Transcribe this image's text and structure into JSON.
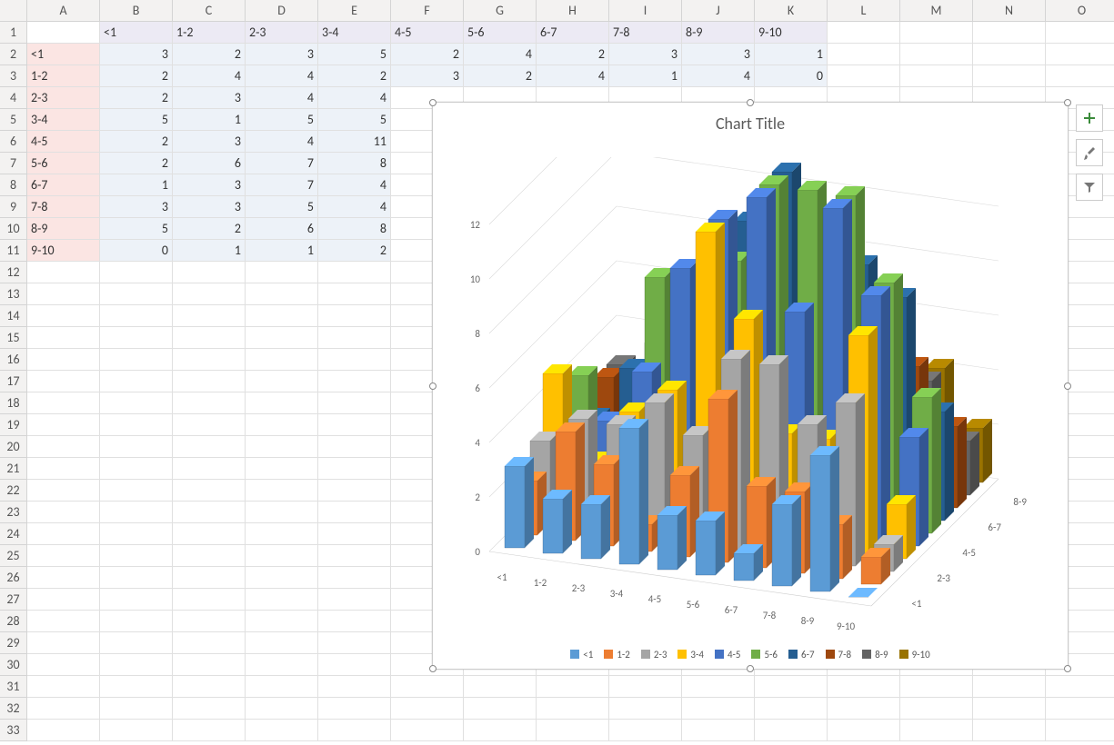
{
  "columns": [
    "A",
    "B",
    "C",
    "D",
    "E",
    "F",
    "G",
    "H",
    "I",
    "J",
    "K",
    "L",
    "M",
    "N",
    "O"
  ],
  "rowCount": 33,
  "colHeaders": [
    "<1",
    "1-2",
    "2-3",
    "3-4",
    "4-5",
    "5-6",
    "6-7",
    "7-8",
    "8-9",
    "9-10"
  ],
  "rowCats": [
    "<1",
    "1-2",
    "2-3",
    "3-4",
    "4-5",
    "5-6",
    "6-7",
    "7-8",
    "8-9",
    "9-10"
  ],
  "table": [
    [
      3,
      2,
      3,
      5,
      2,
      4,
      2,
      3,
      3,
      1
    ],
    [
      2,
      4,
      4,
      2,
      3,
      2,
      4,
      1,
      4,
      0
    ],
    [
      2,
      3,
      4,
      4,
      null,
      null,
      null,
      null,
      null,
      null
    ],
    [
      5,
      1,
      5,
      5,
      null,
      null,
      null,
      null,
      null,
      null
    ],
    [
      2,
      3,
      4,
      11,
      null,
      null,
      null,
      null,
      null,
      null
    ],
    [
      2,
      6,
      7,
      8,
      null,
      null,
      null,
      null,
      null,
      null
    ],
    [
      1,
      3,
      7,
      4,
      null,
      null,
      null,
      null,
      null,
      null
    ],
    [
      3,
      3,
      5,
      4,
      null,
      null,
      null,
      null,
      null,
      null
    ],
    [
      5,
      2,
      6,
      8,
      null,
      null,
      null,
      null,
      null,
      null
    ],
    [
      0,
      1,
      1,
      2,
      null,
      null,
      null,
      null,
      null,
      null
    ]
  ],
  "chart_data": {
    "type": "bar",
    "title": "Chart Title",
    "categories": [
      "<1",
      "1-2",
      "2-3",
      "3-4",
      "4-5",
      "5-6",
      "6-7",
      "7-8",
      "8-9",
      "9-10"
    ],
    "depth_categories": [
      "<1",
      "1-2",
      "2-3",
      "3-4",
      "4-5",
      "5-6",
      "6-7",
      "7-8",
      "8-9",
      "9-10"
    ],
    "depth_labels_visible": [
      "<1",
      "2-3",
      "4-5",
      "6-7",
      "8-9"
    ],
    "y_ticks": [
      0,
      2,
      4,
      6,
      8,
      10,
      12
    ],
    "ylim": [
      0,
      12
    ],
    "series": [
      {
        "name": "<1",
        "color": "#5b9bd5",
        "values": [
          3,
          2,
          2,
          5,
          2,
          2,
          1,
          3,
          5,
          0
        ]
      },
      {
        "name": "1-2",
        "color": "#ed7d31",
        "values": [
          2,
          4,
          3,
          1,
          3,
          6,
          3,
          3,
          2,
          1
        ]
      },
      {
        "name": "2-3",
        "color": "#a5a5a5",
        "values": [
          3,
          4,
          4,
          5,
          4,
          7,
          7,
          5,
          6,
          1
        ]
      },
      {
        "name": "3-4",
        "color": "#ffc000",
        "values": [
          5,
          2,
          4,
          5,
          11,
          8,
          4,
          4,
          8,
          2
        ]
      },
      {
        "name": "4-5",
        "color": "#4472c4",
        "values": [
          2,
          3,
          5,
          9,
          11,
          12,
          8,
          12,
          9,
          4
        ]
      },
      {
        "name": "5-6",
        "color": "#70ad47",
        "values": [
          4,
          2,
          8,
          6,
          9,
          12,
          12,
          12,
          9,
          5
        ]
      },
      {
        "name": "6-7",
        "color": "#255e91",
        "values": [
          2,
          4,
          6,
          7,
          10,
          12,
          10,
          9,
          8,
          4
        ]
      },
      {
        "name": "7-8",
        "color": "#9e480e",
        "values": [
          3,
          1,
          5,
          5,
          7,
          9,
          8,
          6,
          5,
          3
        ]
      },
      {
        "name": "8-9",
        "color": "#636363",
        "values": [
          3,
          4,
          6,
          7,
          8,
          7,
          6,
          5,
          4,
          2
        ]
      },
      {
        "name": "9-10",
        "color": "#997300",
        "values": [
          1,
          0,
          4,
          5,
          7,
          7,
          6,
          5,
          4,
          2
        ]
      }
    ]
  },
  "tools": {
    "add": "chart-elements-button",
    "style": "chart-styles-button",
    "filter": "chart-filter-button"
  }
}
